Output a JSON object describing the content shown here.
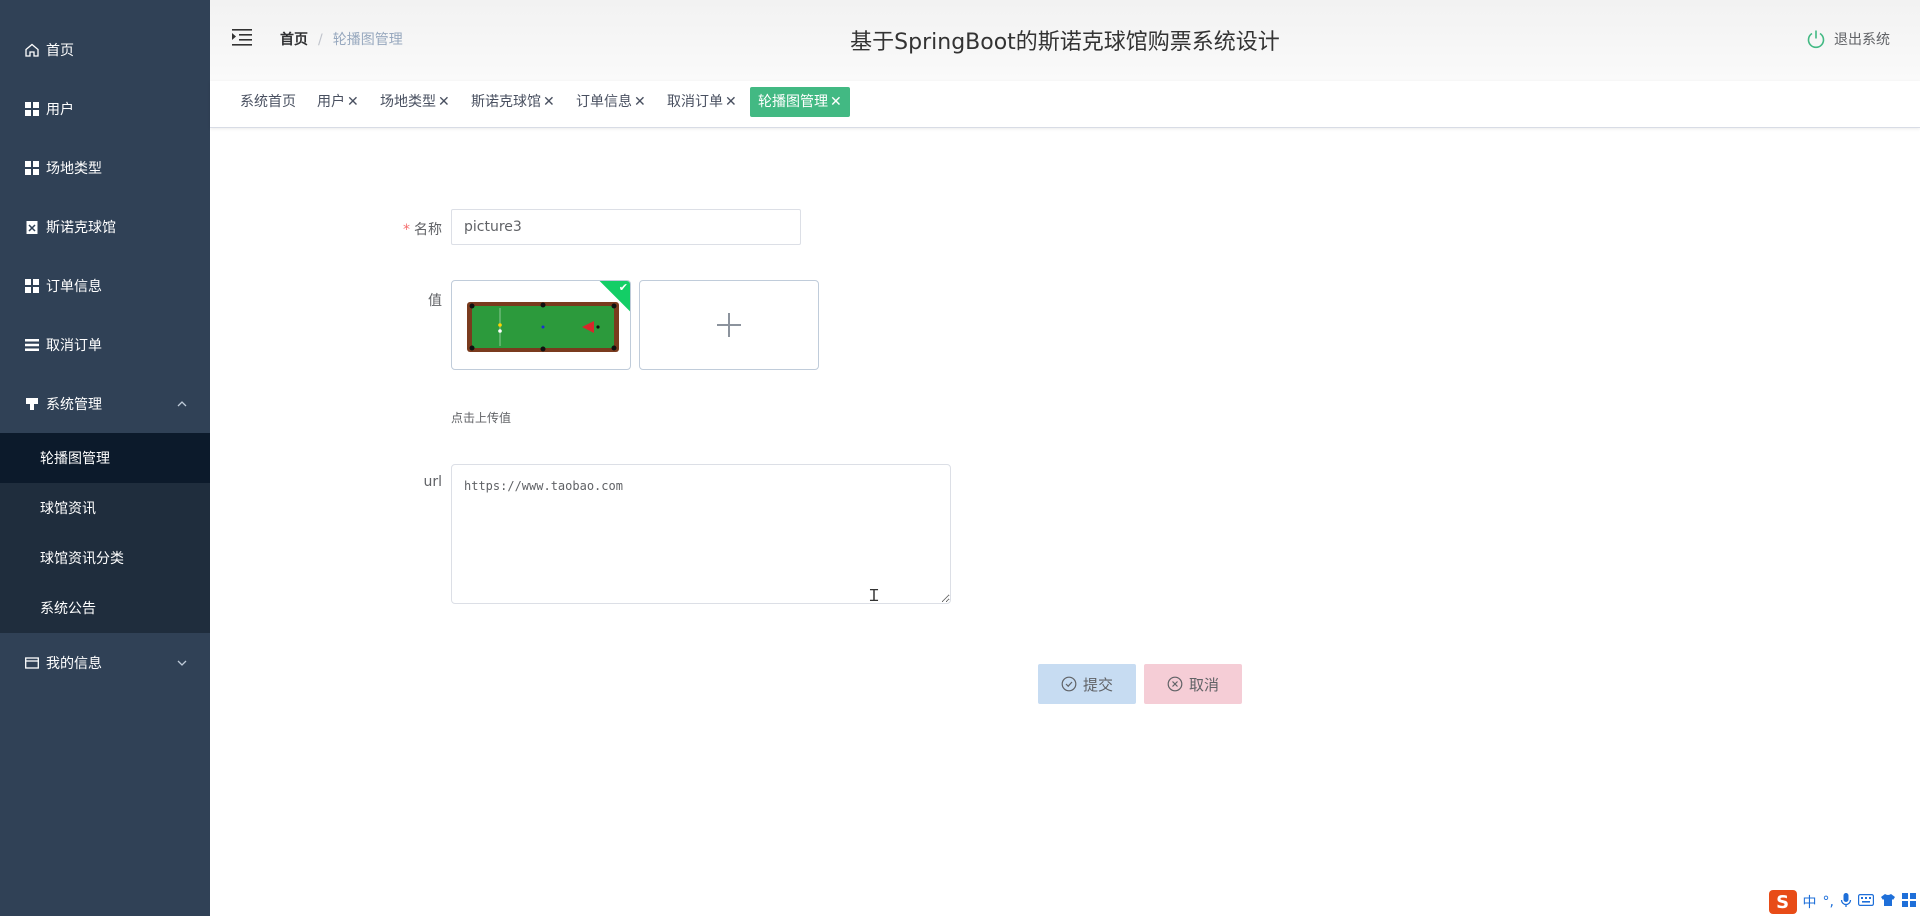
{
  "sidebar": {
    "items": [
      {
        "label": "首页",
        "icon": "home-icon"
      },
      {
        "label": "用户",
        "icon": "grid-icon"
      },
      {
        "label": "场地类型",
        "icon": "grid-icon"
      },
      {
        "label": "斯诺克球馆",
        "icon": "clipboard-icon"
      },
      {
        "label": "订单信息",
        "icon": "grid-icon"
      },
      {
        "label": "取消订单",
        "icon": "list-icon"
      },
      {
        "label": "系统管理",
        "icon": "stamp-icon"
      }
    ],
    "submenu": [
      {
        "label": "轮播图管理",
        "active": true
      },
      {
        "label": "球馆资讯"
      },
      {
        "label": "球馆资讯分类"
      },
      {
        "label": "系统公告"
      }
    ],
    "my_info": {
      "label": "我的信息",
      "icon": "card-icon"
    }
  },
  "header": {
    "breadcrumb_home": "首页",
    "breadcrumb_sep": "/",
    "breadcrumb_current": "轮播图管理",
    "title": "基于SpringBoot的斯诺克球馆购票系统设计",
    "logout": "退出系统"
  },
  "tags": [
    {
      "label": "系统首页"
    },
    {
      "label": "用户"
    },
    {
      "label": "场地类型"
    },
    {
      "label": "斯诺克球馆"
    },
    {
      "label": "订单信息"
    },
    {
      "label": "取消订单"
    },
    {
      "label": "轮播图管理",
      "active": true
    }
  ],
  "form": {
    "name_label": "名称",
    "name_required": "*",
    "name_value": "picture3",
    "value_label": "值",
    "upload_hint": "点击上传值",
    "url_label": "url",
    "url_value": "https://www.taobao.com",
    "submit": "提交",
    "cancel": "取消"
  },
  "ime": {
    "logo": "S",
    "lang": "中"
  },
  "colors": {
    "sidebar_bg": "#304156",
    "submenu_bg": "#1f2d3d",
    "active_tag": "#42b983",
    "submit_bg": "#c7dcf2",
    "cancel_bg": "#f5cdd6"
  }
}
